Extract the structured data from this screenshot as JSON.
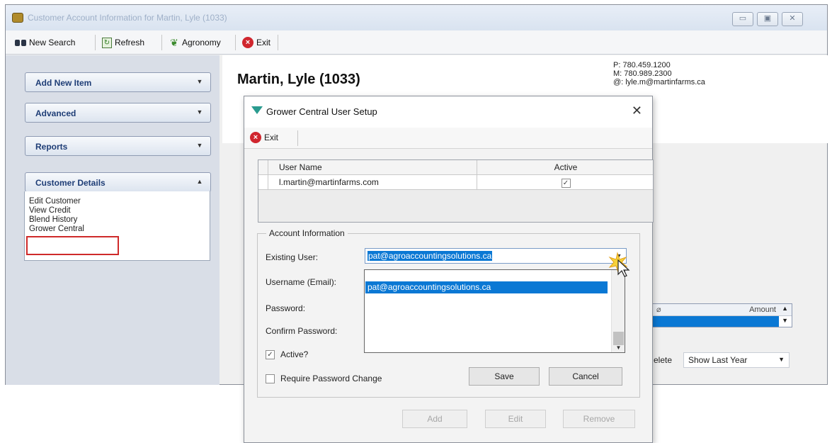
{
  "window": {
    "title": "Customer Account Information for Martin, Lyle (1033)",
    "min_glyph": "▭",
    "max_glyph": "▣",
    "close_glyph": "✕"
  },
  "toolbar": {
    "new_search": "New Search",
    "refresh": "Refresh",
    "agronomy": "Agronomy",
    "exit": "Exit"
  },
  "left_panel": {
    "groups": [
      {
        "label": "Add New Item",
        "chevron": "▼"
      },
      {
        "label": "Advanced",
        "chevron": "▼"
      },
      {
        "label": "Reports",
        "chevron": "▼"
      },
      {
        "label": "Customer Details",
        "chevron": "▲"
      }
    ],
    "details_items": [
      "Edit Customer",
      "View Credit",
      "Blend History",
      "Grower Central"
    ]
  },
  "customer": {
    "name": "Martin, Lyle (1033)",
    "phone": "P:  780.459.1200",
    "mobile": "M:  780.989.2300",
    "email": "@:  lyle.m@martinfarms.ca"
  },
  "background": {
    "amount_header": "Amount",
    "show_range": "Show Last Year",
    "delete_fragment": "elete"
  },
  "dialog": {
    "title": "Grower Central User Setup",
    "close_glyph": "✕",
    "exit_label": "Exit",
    "grid": {
      "headers": [
        "User Name",
        "Active"
      ],
      "rows": [
        {
          "user_name": "l.martin@martinfarms.com",
          "active": "✓"
        }
      ]
    },
    "account_section": "Account Information",
    "labels": {
      "existing_user": "Existing User:",
      "username": "Username (Email):",
      "password": "Password:",
      "confirm_password": "Confirm Password:"
    },
    "existing_user_value": "pat@agroaccountingsolutions.ca",
    "dropdown_items": [
      "pat@agroaccountingsolutions.ca"
    ],
    "active_label": "Active?",
    "active_checked": "✓",
    "require_pw_label": "Require Password Change",
    "save": "Save",
    "cancel": "Cancel",
    "add": "Add",
    "edit": "Edit",
    "remove": "Remove"
  }
}
